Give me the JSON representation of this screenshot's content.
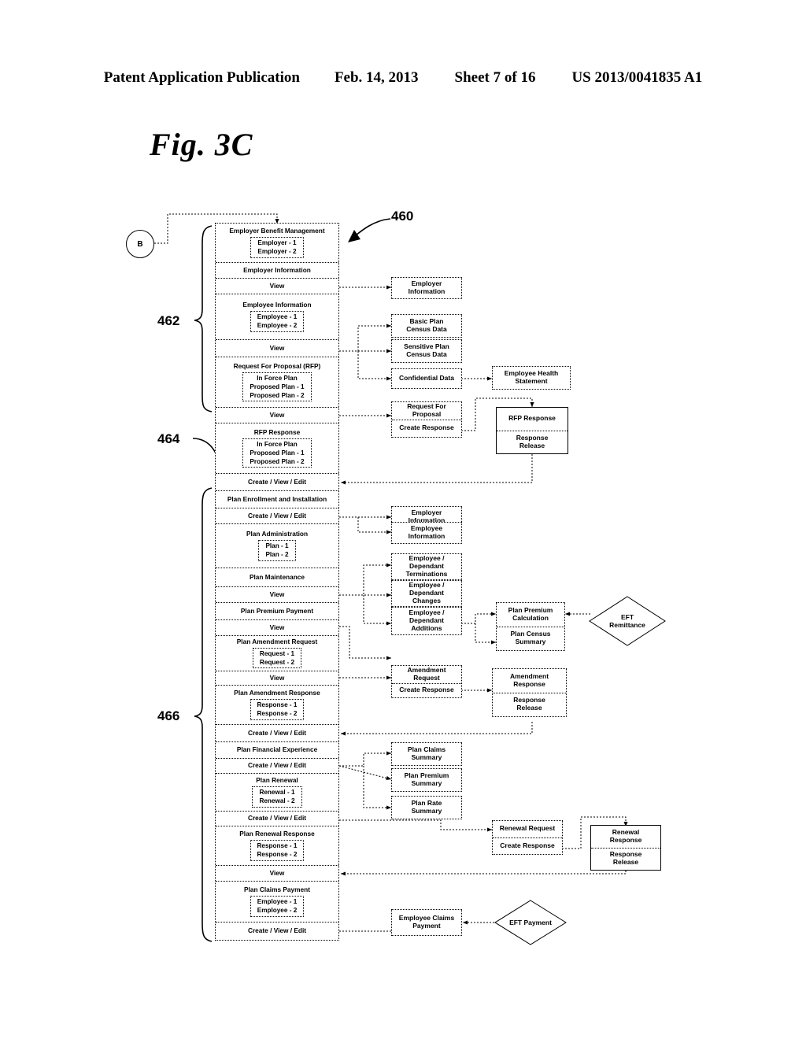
{
  "header": {
    "publication": "Patent Application Publication",
    "date": "Feb. 14, 2013",
    "sheet": "Sheet 7 of 16",
    "number": "US 2013/0041835 A1"
  },
  "figure": {
    "label": "Fig. 3C",
    "callout": "460",
    "connector_b": "B",
    "refs": {
      "upper": "462",
      "middle": "464",
      "lower": "466"
    }
  },
  "main_column": {
    "rows": [
      {
        "header": "Employer Benefit Management",
        "items": [
          "Employer - 1",
          "Employer - 2"
        ]
      },
      {
        "header": "Employer Information"
      },
      {
        "action": "View"
      },
      {
        "header": "Employee Information",
        "items": [
          "Employee - 1",
          "Employee - 2"
        ]
      },
      {
        "action": "View"
      },
      {
        "header": "Request For Proposal (RFP)",
        "items": [
          "In Force Plan",
          "Proposed Plan - 1",
          "Proposed Plan - 2"
        ]
      },
      {
        "action": "View"
      },
      {
        "header": "RFP Response",
        "items": [
          "In Force Plan",
          "Proposed Plan - 1",
          "Proposed Plan - 2"
        ]
      },
      {
        "action": "Create / View / Edit"
      },
      {
        "header": "Plan Enrollment and Installation"
      },
      {
        "action": "Create / View / Edit"
      },
      {
        "header": "Plan Administration",
        "items": [
          "Plan - 1",
          "Plan - 2"
        ]
      },
      {
        "header": "Plan Maintenance"
      },
      {
        "action": "View"
      },
      {
        "header": "Plan Premium Payment"
      },
      {
        "action": "View"
      },
      {
        "header": "Plan Amendment Request",
        "items": [
          "Request - 1",
          "Request - 2"
        ]
      },
      {
        "action": "View"
      },
      {
        "header": "Plan Amendment Response",
        "items": [
          "Response - 1",
          "Response - 2"
        ]
      },
      {
        "action": "Create / View / Edit"
      },
      {
        "header": "Plan Financial Experience"
      },
      {
        "action": "Create / View / Edit"
      },
      {
        "header": "Plan Renewal",
        "items": [
          "Renewal - 1",
          "Renewal - 2"
        ]
      },
      {
        "action": "Create / View / Edit"
      },
      {
        "header": "Plan Renewal Response",
        "items": [
          "Response - 1",
          "Response - 2"
        ]
      },
      {
        "action": "View"
      },
      {
        "header": "Plan Claims Payment",
        "items": [
          "Employee - 1",
          "Employee - 2"
        ]
      },
      {
        "action": "Create / View / Edit"
      }
    ]
  },
  "right_nodes": {
    "employer_information_1": "Employer\nInformation",
    "basic_plan_census": "Basic Plan\nCensus Data",
    "sensitive_plan_census": "Sensitive Plan\nCensus Data",
    "confidential_data": "Confidential Data",
    "employee_health_statement": "Employee Health\nStatement",
    "request_for_proposal": "Request For\nProposal",
    "rfp_create_response": "Create Response",
    "rfp_response": "RFP Response",
    "rfp_response_release": "Response\nRelease",
    "employer_information_2": "Employer\nInformation",
    "employee_information": "Employee\nInformation",
    "dependant_terminations": "Employee /\nDependant\nTerminations",
    "dependant_changes": "Employee /\nDependant\nChanges",
    "dependant_additions": "Employee /\nDependant\nAdditions",
    "plan_premium_calculation": "Plan Premium\nCalculation",
    "plan_census_summary": "Plan Census\nSummary",
    "eft_remittance": "EFT\nRemittance",
    "amendment_request": "Amendment\nRequest",
    "amendment_create_response": "Create Response",
    "amendment_response": "Amendment\nResponse",
    "amendment_response_release": "Response\nRelease",
    "plan_claims_summary": "Plan Claims\nSummary",
    "plan_premium_summary": "Plan Premium\nSummary",
    "plan_rate_summary": "Plan Rate\nSummary",
    "renewal_request": "Renewal Request",
    "renewal_create_response": "Create Response",
    "renewal_response": "Renewal\nResponse",
    "renewal_response_release": "Response\nRelease",
    "employee_claims_payment": "Employee Claims\nPayment",
    "eft_payment": "EFT Payment"
  }
}
